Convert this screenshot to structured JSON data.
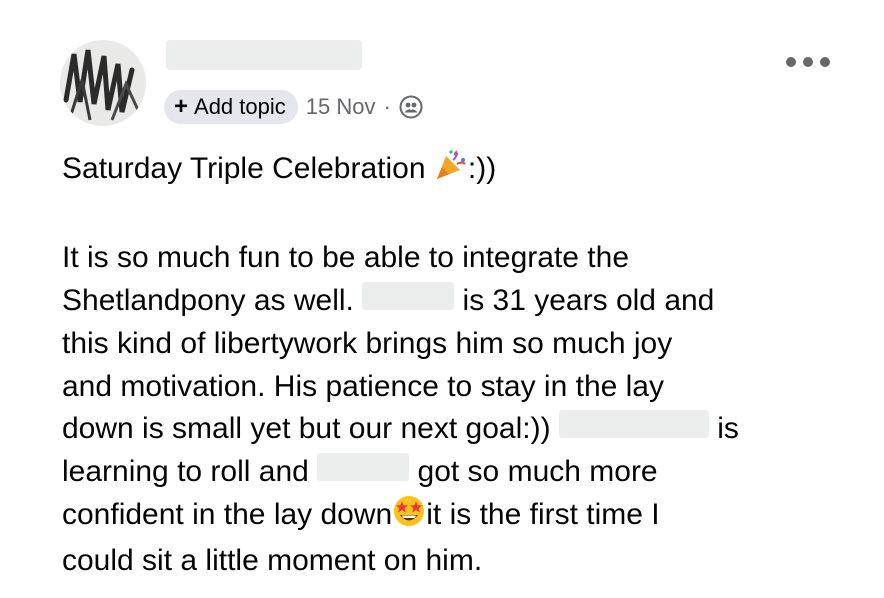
{
  "post": {
    "author_name": "",
    "add_topic_label": "Add topic",
    "date": "15 Nov",
    "separator": "·",
    "more_options": "•••",
    "title_text": "Saturday Triple Celebration",
    "title_suffix": ":))",
    "line1": "It is so much fun to be able to integrate the",
    "line2a": "Shetlandpony as well.",
    "line2b": "is 31 years old and",
    "line3": "this kind of libertywork brings him so much joy",
    "line4": "and motivation. His patience to stay in the lay",
    "line5a": "down is small yet but our next goal:))",
    "line5b": "is",
    "line6a": "learning to roll and",
    "line6b": "got so much more",
    "line7a": "confident in the lay down",
    "line7b": "it is the first time I",
    "line8": "could sit a little moment on him."
  },
  "icons": {
    "plus": "plus-icon",
    "audience": "friends-audience-icon",
    "party": "party-popper-emoji",
    "star_struck": "star-struck-emoji"
  },
  "colors": {
    "text": "#050505",
    "meta": "#65676b",
    "chip_bg": "#e4e6eb",
    "redaction": "#eceeee"
  }
}
